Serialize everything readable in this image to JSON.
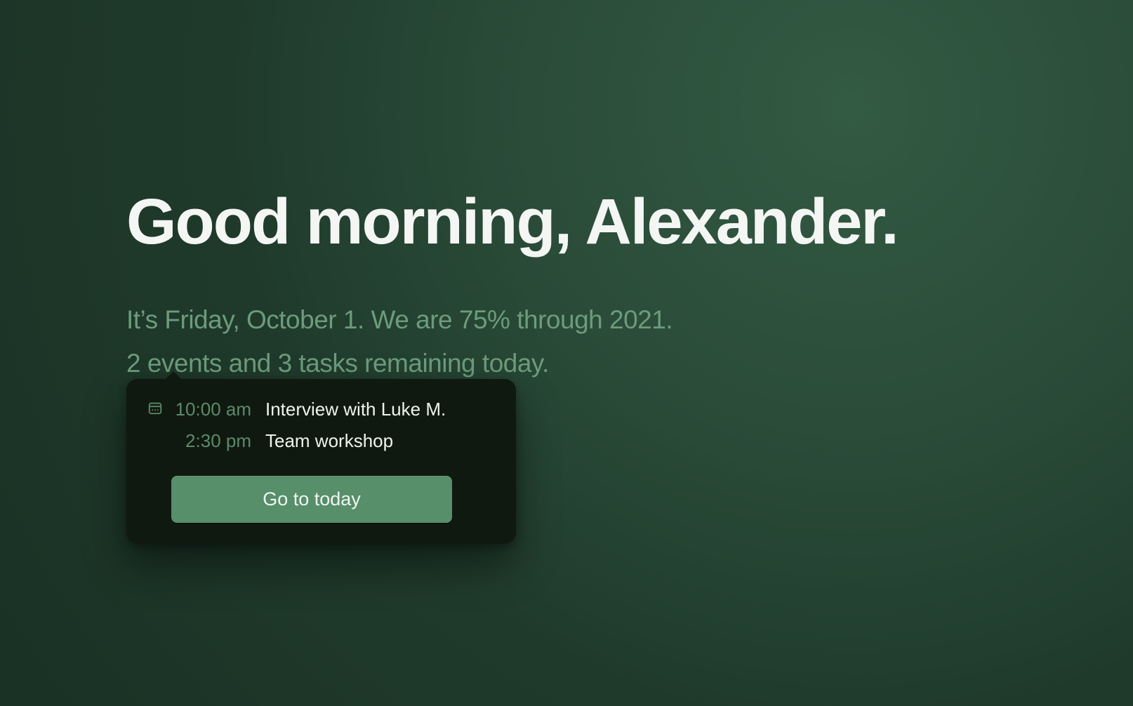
{
  "greeting": "Good morning, Alexander.",
  "date_line": "It’s Friday, October 1. We are 75% through 2021.",
  "summary_line": "2 events and 3 tasks remaining today.",
  "popover": {
    "events": [
      {
        "time": "10:00 am",
        "title": "Interview with Luke M."
      },
      {
        "time": "2:30 pm",
        "title": "Team workshop"
      }
    ],
    "cta_label": "Go to today"
  },
  "colors": {
    "background": "#1f3a2b",
    "text_primary": "#f4f6f4",
    "text_secondary": "#6d9b7c",
    "popover_bg": "#10190f",
    "accent": "#568f6a"
  }
}
